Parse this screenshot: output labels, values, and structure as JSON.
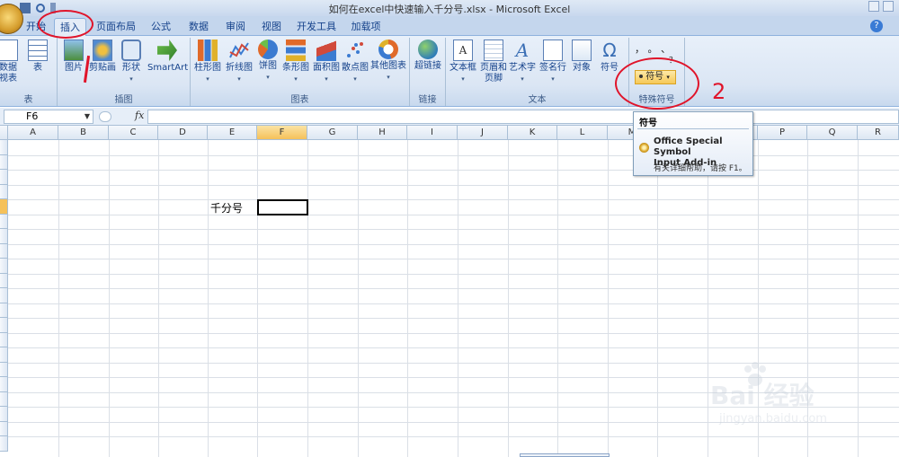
{
  "window": {
    "title": "如何在excel中快速输入千分号.xlsx - Microsoft Excel"
  },
  "tabs": [
    "开始",
    "插入",
    "页面布局",
    "公式",
    "数据",
    "审阅",
    "视图",
    "开发工具",
    "加载项"
  ],
  "active_tab": "插入",
  "ribbon": {
    "groups": [
      {
        "label": "表",
        "buttons": [
          {
            "label": "数据\n视表"
          },
          {
            "label": "表"
          }
        ]
      },
      {
        "label": "插图",
        "buttons": [
          {
            "label": "图片"
          },
          {
            "label": "剪贴画"
          },
          {
            "label": "形状"
          },
          {
            "label": "SmartArt"
          }
        ]
      },
      {
        "label": "图表",
        "buttons": [
          {
            "label": "柱形图"
          },
          {
            "label": "折线图"
          },
          {
            "label": "饼图"
          },
          {
            "label": "条形图"
          },
          {
            "label": "面积图"
          },
          {
            "label": "散点图"
          },
          {
            "label": "其他图表"
          }
        ]
      },
      {
        "label": "链接",
        "buttons": [
          {
            "label": "超链接"
          }
        ]
      },
      {
        "label": "文本",
        "buttons": [
          {
            "label": "文本框"
          },
          {
            "label": "页眉和\n页脚"
          },
          {
            "label": "艺术字"
          },
          {
            "label": "签名行"
          },
          {
            "label": "对象"
          },
          {
            "label": "符号"
          }
        ]
      },
      {
        "label": "特殊符号",
        "buttons": [
          {
            "label": "符号"
          }
        ]
      }
    ]
  },
  "special_symbols_row": "， 。 、",
  "special_symbols_row2": "？",
  "formula_bar": {
    "name_box": "F6",
    "fx": "fx",
    "content": ""
  },
  "columns": [
    "A",
    "B",
    "C",
    "D",
    "E",
    "F",
    "G",
    "H",
    "I",
    "J",
    "K",
    "L",
    "M",
    "N",
    "O",
    "P",
    "Q",
    "R"
  ],
  "selected_column": "F",
  "cells": [
    {
      "ref": "E6",
      "value": "千分号"
    }
  ],
  "tooltip": {
    "title": "符号",
    "addin_line1": "Office Special Symbol",
    "addin_line2": "Input Add-in",
    "help": "有关详细帮助，请按 F1。"
  },
  "annotation_number": "2",
  "watermark": {
    "text": "Bai 经验",
    "url": "jingyan.baidu.com"
  },
  "colors": {
    "accent_red": "#e0142a",
    "ribbon": "#dbe6f4",
    "selected_header": "#f5c15a"
  }
}
